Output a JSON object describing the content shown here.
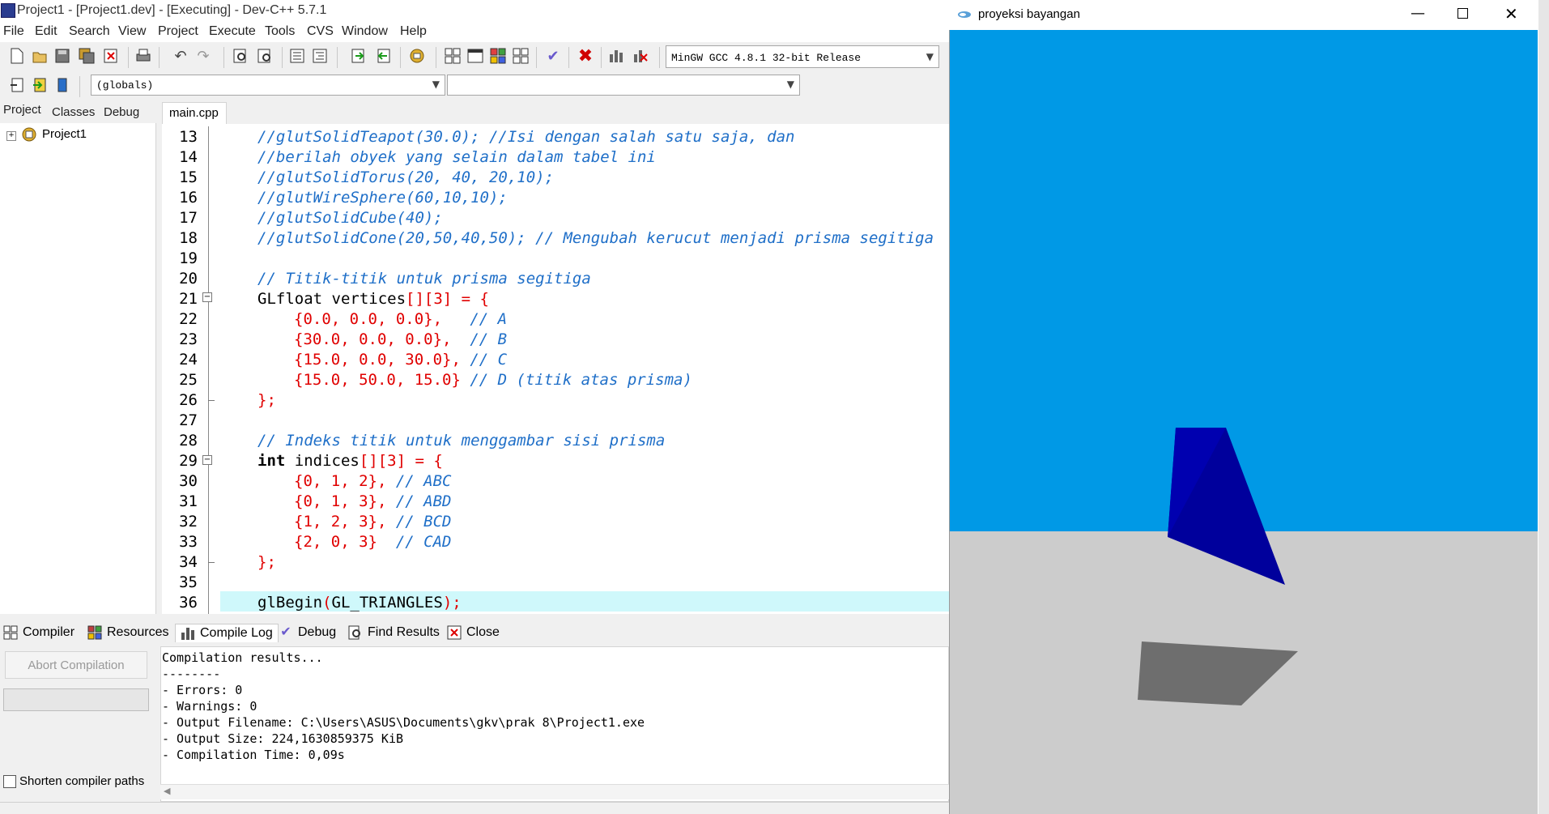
{
  "devcpp": {
    "title": "Project1 - [Project1.dev] - [Executing] - Dev-C++ 5.7.1",
    "menu": [
      "File",
      "Edit",
      "Search",
      "View",
      "Project",
      "Execute",
      "Tools",
      "CVS",
      "Window",
      "Help"
    ],
    "compiler_select": "MinGW GCC 4.8.1 32-bit Release",
    "scope_select": "(globals)",
    "function_select": "",
    "left_tabs": [
      "Project",
      "Classes",
      "Debug"
    ],
    "tree_root": "Project1",
    "editor_tab": "main.cpp",
    "code": {
      "l13": "//glutSolidTeapot(30.0); //Isi dengan salah satu saja, dan",
      "l14": "//berilah obyek yang selain dalam tabel ini",
      "l15": "//glutSolidTorus(20, 40, 20,10);",
      "l16": "//glutWireSphere(60,10,10);",
      "l17": "//glutSolidCube(40);",
      "l18": "//glutSolidCone(20,50,40,50); // Mengubah kerucut menjadi prisma segitiga",
      "l20": "// Titik-titik untuk prisma segitiga",
      "l21a": "GLfloat vertices",
      "l21b": "[][3] = {",
      "l22a": "{0.0, 0.0, 0.0},",
      "l22b": "// A",
      "l23a": "{30.0, 0.0, 0.0},",
      "l23b": "// B",
      "l24a": "{15.0, 0.0, 30.0},",
      "l24b": "// C",
      "l25a": "{15.0, 50.0, 15.0}",
      "l25b": "// D (titik atas prisma)",
      "l26": "};",
      "l28": "// Indeks titik untuk menggambar sisi prisma",
      "l29a": "int",
      "l29b": " indices",
      "l29c": "[][3] = {",
      "l30a": "{0, 1, 2},",
      "l30b": "// ABC",
      "l31a": "{0, 1, 3},",
      "l31b": "// ABD",
      "l32a": "{1, 2, 3},",
      "l32b": "// BCD",
      "l33a": "{2, 0, 3}",
      "l33b": "// CAD",
      "l34": "};",
      "l36a": "glBegin",
      "l36b": "(",
      "l36c": "GL_TRIANGLES",
      "l36d": ");"
    },
    "line_numbers": [
      "13",
      "14",
      "15",
      "16",
      "17",
      "18",
      "19",
      "20",
      "21",
      "22",
      "23",
      "24",
      "25",
      "26",
      "27",
      "28",
      "29",
      "30",
      "31",
      "32",
      "33",
      "34",
      "35",
      "36"
    ],
    "bottom_tabs": [
      "Compiler",
      "Resources",
      "Compile Log",
      "Debug",
      "Find Results",
      "Close"
    ],
    "abort_button": "Abort Compilation",
    "shorten_paths": "Shorten compiler paths",
    "log": [
      "Compilation results...",
      "--------",
      "- Errors: 0",
      "- Warnings: 0",
      "- Output Filename: C:\\Users\\ASUS\\Documents\\gkv\\prak 8\\Project1.exe",
      "- Output Size: 224,1630859375 KiB",
      "- Compilation Time: 0,09s"
    ]
  },
  "glwindow": {
    "title": "proyeksi bayangan",
    "sky_color": "#0099e6",
    "floor_color": "#cccccc",
    "prism_color": "#00009c",
    "prism_face_color": "#0000b0",
    "shadow_color": "#6e6e6e"
  }
}
